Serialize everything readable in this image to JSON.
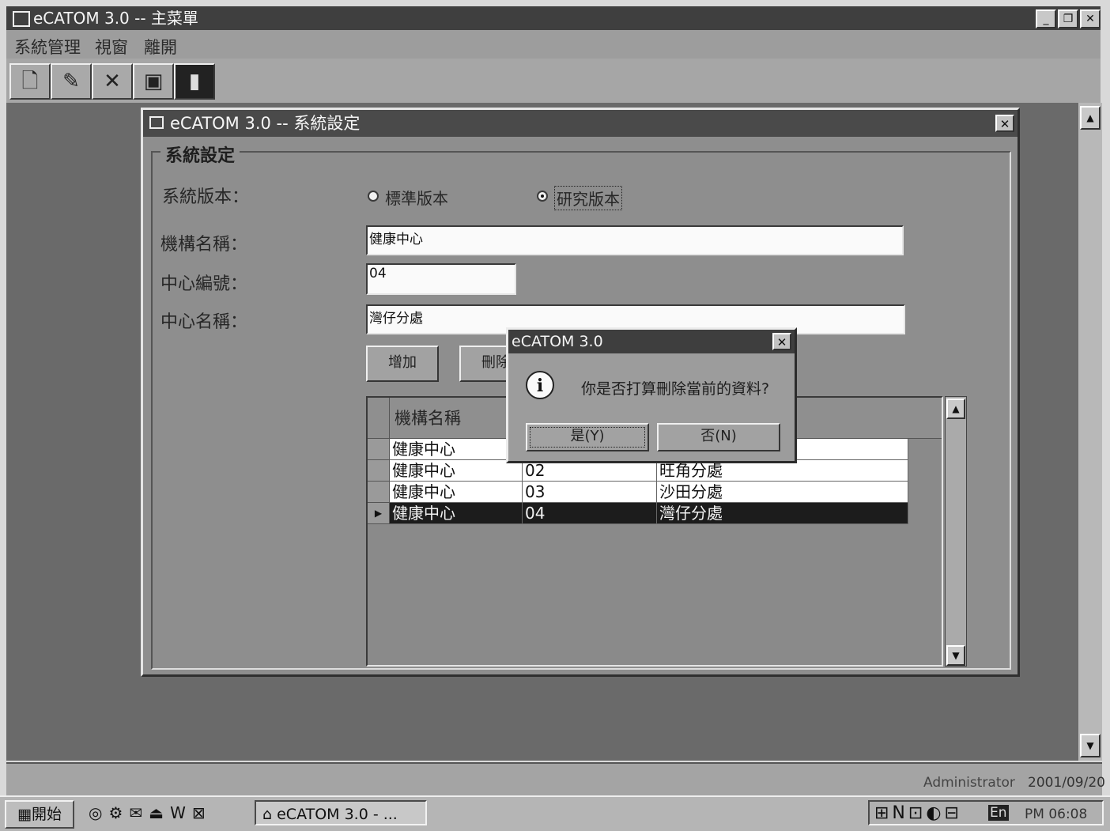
{
  "main_window": {
    "title": "eCATOM 3.0 -- 主菜單",
    "menu": [
      "系統管理",
      "視窗",
      "離開"
    ]
  },
  "toolbar": {
    "icons": [
      "new-document-icon",
      "edit-document-icon",
      "delete-icon",
      "save-icon",
      "exit-door-icon"
    ]
  },
  "settings_window": {
    "title": "eCATOM 3.0 -- 系統設定",
    "group_title": "系統設定",
    "version_label": "系統版本：",
    "radio_standard": "標準版本",
    "radio_research": "研究版本",
    "org_label": "機構名稱：",
    "org_value": "健康中心",
    "center_code_label": "中心編號：",
    "center_code_value": "04",
    "center_name_label": "中心名稱：",
    "center_name_value": "灣仔分處",
    "add_button": "增加",
    "delete_button": "刪除"
  },
  "grid": {
    "header_first": "機構名稱",
    "rows": [
      [
        "健康中心",
        "",
        ""
      ],
      [
        "健康中心",
        "02",
        "旺角分處"
      ],
      [
        "健康中心",
        "03",
        "沙田分處"
      ],
      [
        "健康中心",
        "04",
        "灣仔分處"
      ]
    ],
    "selected_row": 3
  },
  "message_box": {
    "title": "eCATOM 3.0",
    "message": "你是否打算刪除當前的資料?",
    "yes_button": "是(Y)",
    "no_button": "否(N)"
  },
  "status": {
    "user": "Administrator",
    "date": "2001/09/20"
  },
  "taskbar": {
    "start_label": "開始",
    "task_label": "eCATOM 3.0 - ...",
    "clock": "PM 06:08",
    "tray_text": "En"
  }
}
